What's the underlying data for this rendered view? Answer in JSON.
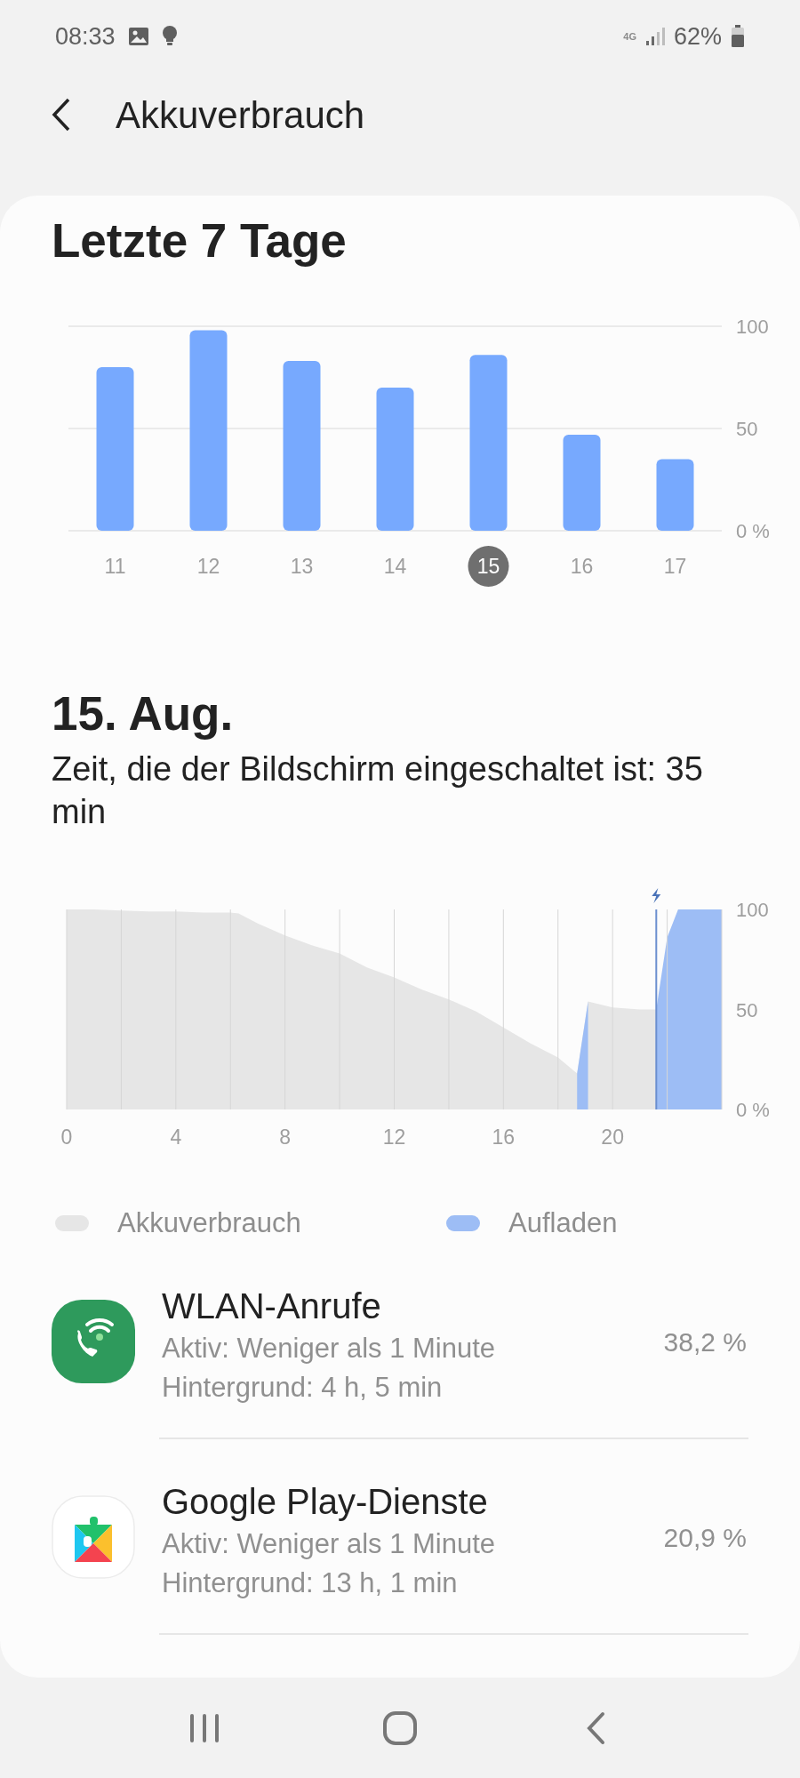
{
  "status_bar": {
    "time": "08:33",
    "network": "4G",
    "battery": "62%"
  },
  "header": {
    "title": "Akkuverbrauch"
  },
  "week": {
    "title": "Letzte 7 Tage",
    "chart_data": {
      "type": "bar",
      "categories": [
        "11",
        "12",
        "13",
        "14",
        "15",
        "16",
        "17"
      ],
      "values": [
        80,
        98,
        83,
        70,
        86,
        47,
        35
      ],
      "grid": true,
      "ylim": [
        0,
        100
      ],
      "yticks": [
        {
          "value": 0,
          "label": "0 %"
        },
        50,
        100
      ]
    },
    "day_states": [
      {
        "selected": false
      },
      {
        "selected": false
      },
      {
        "selected": false
      },
      {
        "selected": false
      },
      {
        "selected": true
      },
      {
        "selected": false
      },
      {
        "selected": false
      }
    ]
  },
  "day": {
    "title": "15. Aug.",
    "screen_time": "Zeit, die der Bildschirm eingeschaltet ist: 35 min",
    "chart_data": {
      "type": "area",
      "x": [
        0,
        1,
        2,
        3,
        4,
        5,
        6,
        6.3,
        7,
        8,
        9,
        10,
        11,
        12,
        13,
        14,
        15,
        16,
        17,
        18,
        18.7,
        19.1,
        20,
        21,
        21.6,
        22,
        22.4,
        23,
        24
      ],
      "xlim": [
        0,
        24
      ],
      "grid": true,
      "legend": true,
      "ref_lines": [
        {
          "axis": "x",
          "value": 21.6
        }
      ],
      "xticks": [
        0,
        4,
        8,
        12,
        16,
        20
      ],
      "ylim": [
        0,
        100
      ],
      "yticks": [
        {
          "value": 0,
          "label": "0 %"
        },
        50,
        100
      ],
      "series": [
        {
          "name": "Akkuverbrauch",
          "color": "#e6e6e6",
          "values": [
            100,
            100,
            99.5,
            99,
            99,
            98.5,
            98.5,
            98,
            93,
            87,
            82,
            78,
            71,
            66,
            60,
            55,
            49,
            41,
            33,
            26,
            18,
            54,
            51,
            50,
            50,
            null,
            null,
            null,
            null
          ]
        },
        {
          "name": "Aufladen",
          "color": "#9dbdf5",
          "values": [
            null,
            null,
            null,
            null,
            null,
            null,
            null,
            null,
            null,
            null,
            null,
            null,
            null,
            null,
            null,
            null,
            null,
            null,
            null,
            null,
            18,
            54,
            null,
            null,
            50,
            86,
            100,
            100,
            100
          ]
        }
      ]
    }
  },
  "apps": [
    {
      "kind": "wifi-calling",
      "name": "WLAN-Anrufe",
      "active": "Aktiv: Weniger als 1 Minute",
      "background": "Hintergrund: 4 h, 5 min",
      "share": "38,2 %"
    },
    {
      "kind": "play-services",
      "name": "Google Play-Dienste",
      "active": "Aktiv: Weniger als 1 Minute",
      "background": "Hintergrund: 13 h, 1 min",
      "share": "20,9 %"
    }
  ]
}
